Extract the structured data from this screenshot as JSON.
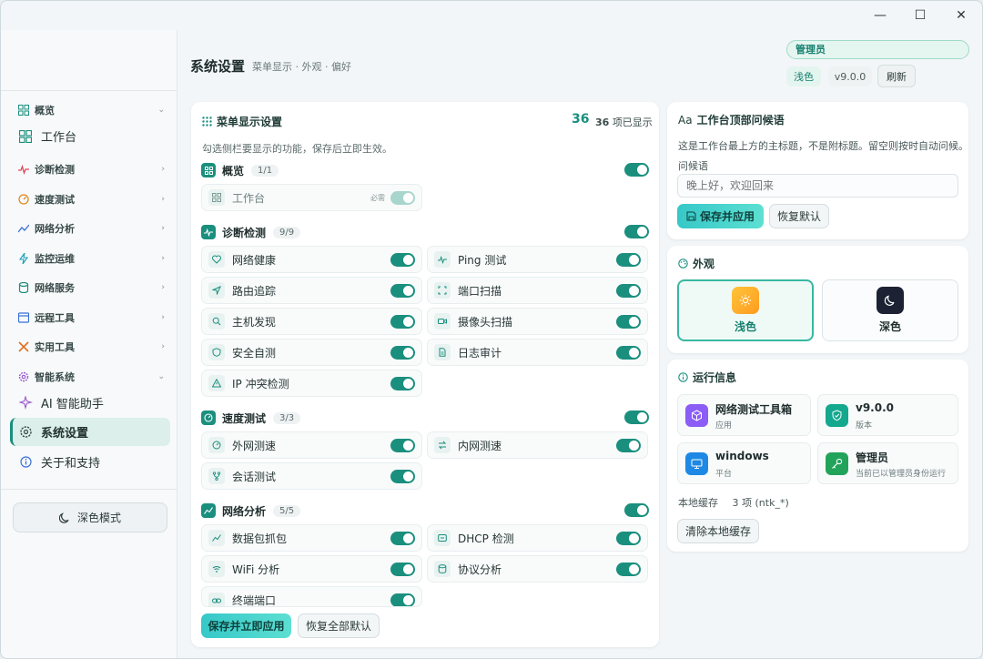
{
  "window": {
    "minimize": "—",
    "maximize": "☐",
    "close": "✕"
  },
  "sidebar": {
    "groups": [
      {
        "label": "概览",
        "icon": "grid-icon"
      },
      {
        "label": "诊断检测",
        "icon": "pulse-icon"
      },
      {
        "label": "速度测试",
        "icon": "gauge-icon"
      },
      {
        "label": "网络分析",
        "icon": "chart-icon"
      },
      {
        "label": "监控运维",
        "icon": "bolt-icon"
      },
      {
        "label": "网络服务",
        "icon": "database-icon"
      },
      {
        "label": "远程工具",
        "icon": "window-icon"
      },
      {
        "label": "实用工具",
        "icon": "tools-icon"
      },
      {
        "label": "智能系统",
        "icon": "gear-icon"
      }
    ],
    "items": {
      "workspace": "工作台",
      "ai": "AI 智能助手",
      "settings": "系统设置",
      "about": "关于和支持"
    },
    "dark_mode": "深色模式"
  },
  "header": {
    "title": "系统设置",
    "subtitle": "菜单显示 · 外观 · 偏好",
    "role": "管理员",
    "theme": "浅色",
    "version": "v9.0.0",
    "refresh": "刷新"
  },
  "menu_settings": {
    "title": "菜单显示设置",
    "count": "36",
    "count_text": "36 项已显示",
    "desc": "勾选侧栏要显示的功能，保存后立即生效。",
    "required": "必需",
    "sections": {
      "overview": {
        "name": "概览",
        "count": "1/1",
        "items": [
          "工作台"
        ]
      },
      "diagnose": {
        "name": "诊断检测",
        "count": "9/9",
        "items": [
          "网络健康",
          "Ping 测试",
          "路由追踪",
          "端口扫描",
          "主机发现",
          "摄像头扫描",
          "安全自测",
          "日志审计",
          "IP 冲突检测"
        ]
      },
      "speed": {
        "name": "速度测试",
        "count": "3/3",
        "items": [
          "外网测速",
          "内网测速",
          "会话测试"
        ]
      },
      "analysis": {
        "name": "网络分析",
        "count": "5/5",
        "items": [
          "数据包抓包",
          "DHCP 检测",
          "WiFi 分析",
          "协议分析",
          "终端端口"
        ]
      }
    },
    "save": "保存并立即应用",
    "reset_all": "恢复全部默认"
  },
  "greeting": {
    "title": "工作台顶部问候语",
    "title_prefix": "Aa",
    "desc": "这是工作台最上方的主标题，不是附标题。留空则按时自动问候。",
    "label": "问候语",
    "placeholder": "晚上好，欢迎回来",
    "save": "保存并应用",
    "reset": "恢复默认"
  },
  "appearance": {
    "title": "外观",
    "light": "浅色",
    "dark": "深色"
  },
  "run_info": {
    "title": "运行信息",
    "tiles": [
      {
        "value": "网络测试工具箱",
        "label": "应用",
        "color": "#8b5cf6"
      },
      {
        "value": "v9.0.0",
        "label": "版本",
        "color": "#14a88f"
      },
      {
        "value": "windows",
        "label": "平台",
        "color": "#1e88e5"
      },
      {
        "value": "管理员",
        "label": "当前已以管理员身份运行",
        "color": "#22a35a"
      }
    ],
    "cache_label": "本地缓存",
    "cache_value": "3 项 (ntk_*)",
    "clear_cache": "清除本地缓存"
  },
  "colors": {
    "accent": "#1a8f7e",
    "toggle_on": "#1a8f7e"
  }
}
